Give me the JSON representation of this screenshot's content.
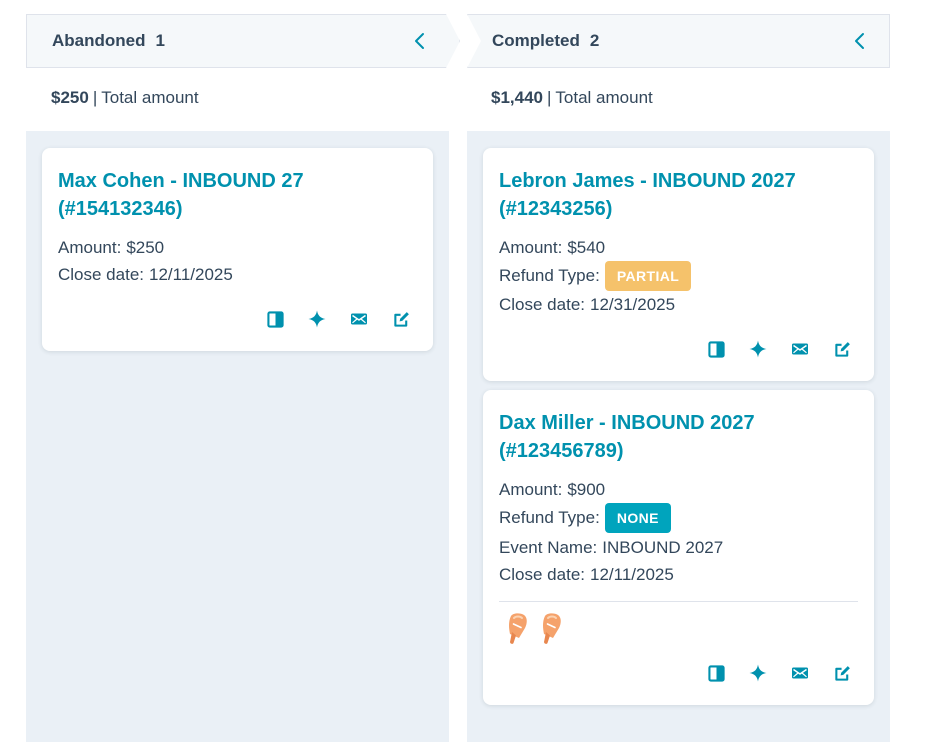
{
  "colors": {
    "accent": "#0091ae",
    "text": "#33475b",
    "column_bg": "#eaf0f6",
    "header_bg": "#f5f8fa",
    "badge_partial": "#f5c26b",
    "badge_none": "#00a4bd",
    "icon": "#0091ae",
    "emoji": "#f5a26b"
  },
  "columns": [
    {
      "title": "Abandoned",
      "count": "1",
      "summary_amount": "$250",
      "summary_separator": "|",
      "summary_label": "Total amount",
      "collapse_icon": "chevron-left-icon",
      "cards": [
        {
          "title": "Max Cohen - INBOUND 27 (#154132346)",
          "amount_label": "Amount:",
          "amount_value": "$250",
          "close_date_label": "Close date:",
          "close_date_value": "12/11/2025",
          "actions": [
            "preview-panel-icon",
            "sparkle-icon",
            "email-icon",
            "edit-icon"
          ]
        }
      ]
    },
    {
      "title": "Completed",
      "count": "2",
      "summary_amount": "$1,440",
      "summary_separator": "|",
      "summary_label": "Total amount",
      "collapse_icon": "chevron-left-icon",
      "cards": [
        {
          "title": "Lebron James - INBOUND 2027 (#12343256)",
          "amount_label": "Amount:",
          "amount_value": "$540",
          "refund_label": "Refund Type:",
          "refund_value": "PARTIAL",
          "close_date_label": "Close date:",
          "close_date_value": "12/31/2025",
          "actions": [
            "preview-panel-icon",
            "sparkle-icon",
            "email-icon",
            "edit-icon"
          ]
        },
        {
          "title": "Dax Miller - INBOUND 2027 (#123456789)",
          "amount_label": "Amount:",
          "amount_value": "$900",
          "refund_label": "Refund Type:",
          "refund_value": "NONE",
          "event_label": "Event Name:",
          "event_value": "INBOUND 2027",
          "close_date_label": "Close date:",
          "close_date_value": "12/11/2025",
          "tags": [
            "popsicle-icon",
            "popsicle-icon"
          ],
          "actions": [
            "preview-panel-icon",
            "sparkle-icon",
            "email-icon",
            "edit-icon"
          ]
        }
      ]
    }
  ]
}
